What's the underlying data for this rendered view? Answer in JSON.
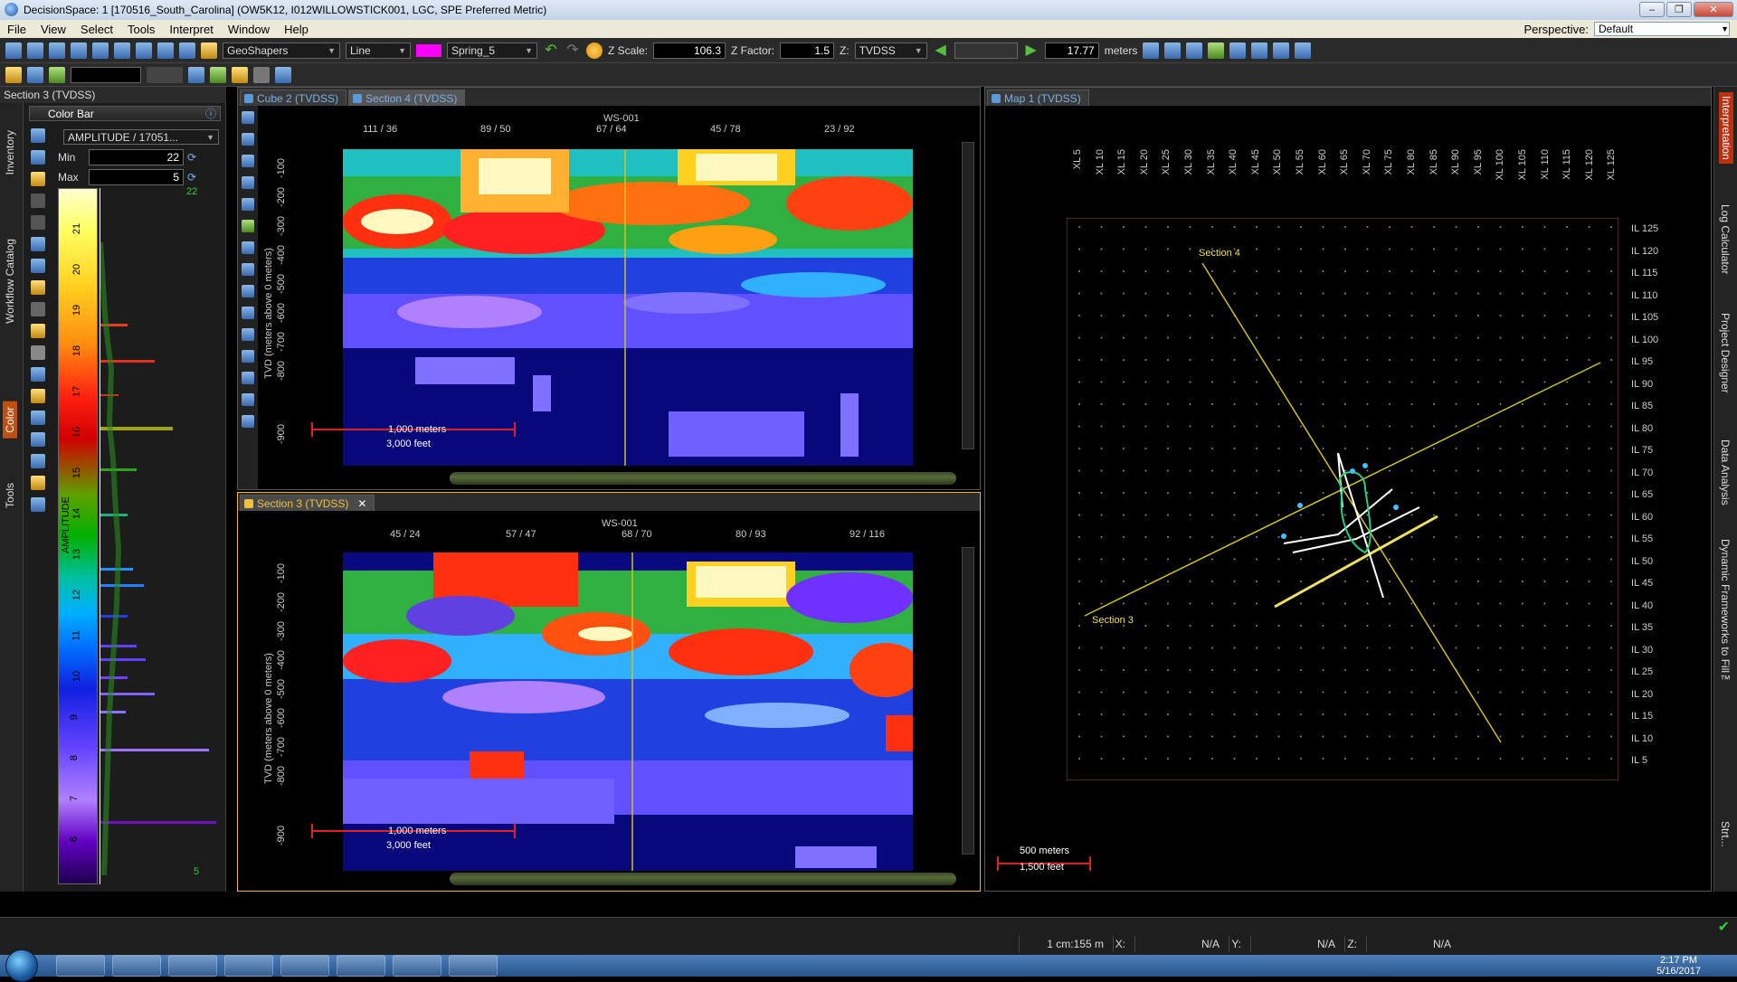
{
  "window": {
    "title": "DecisionSpace: 1 [170516_South_Carolina] (OW5K12, I012WILLOWSTICK001, LGC, SPE Preferred Metric)",
    "min": "–",
    "max": "❐",
    "close": "✕"
  },
  "menu": {
    "items": [
      "File",
      "View",
      "Select",
      "Tools",
      "Interpret",
      "Window",
      "Help"
    ],
    "perspective_label": "Perspective:",
    "perspective_value": "Default"
  },
  "toolbar": {
    "shape_combo": "GeoShapers",
    "style_combo": "Line",
    "color_hex": "#ff00ff",
    "colormap_combo": "Spring_5",
    "zscale_label": "Z Scale:",
    "zscale_value": "106.3",
    "zfactor_label": "Z Factor:",
    "zfactor_value": "1.5",
    "z_label": "Z:",
    "z_value": "TVDSS",
    "distance_value": "17.77",
    "distance_unit": "meters"
  },
  "left_panel": {
    "title": "Section 3 (TVDSS)",
    "side_tabs": [
      "Inventory",
      "Workflow Catalog",
      "Color",
      "Tools"
    ],
    "colorbar_header": "Color Bar",
    "attribute_combo": "AMPLITUDE / 17051...",
    "min_label": "Min",
    "min_value": "22",
    "max_label": "Max",
    "max_value": "5",
    "top_marker": "22",
    "bottom_marker": "5",
    "axis_title": "AMPLITUDE",
    "ticks": [
      "21",
      "20",
      "19",
      "18",
      "17",
      "16",
      "15",
      "14",
      "13",
      "12",
      "11",
      "10",
      "9",
      "8",
      "7",
      "6"
    ]
  },
  "cube_view": {
    "tabs": [
      {
        "label": "Cube 2 (TVDSS)",
        "active": false
      },
      {
        "label": "Section 4 (TVDSS)",
        "active": true
      }
    ],
    "well": "WS-001",
    "top_ticks": [
      "111 / 36",
      "89 / 50",
      "67 / 64",
      "45 / 78",
      "23 / 92"
    ],
    "depth_axis_label": "TVD (meters above 0 meters)",
    "depth_ticks": [
      "-100",
      "-200",
      "-300",
      "-400",
      "-500",
      "-600",
      "-700",
      "-800",
      "-900"
    ],
    "scale_meters": "1,000 meters",
    "scale_feet": "3,000 feet"
  },
  "section3_view": {
    "tab": "Section 3 (TVDSS)",
    "close": "✕",
    "well": "WS-001",
    "top_ticks": [
      "45 / 24",
      "57 / 47",
      "68 / 70",
      "80 / 93",
      "92 / 116"
    ],
    "depth_axis_label": "TVD (meters above 0 meters)",
    "depth_ticks": [
      "-100",
      "-200",
      "-300",
      "-400",
      "-500",
      "-600",
      "-700",
      "-800",
      "-900"
    ],
    "scale_meters": "1,000 meters",
    "scale_feet": "3,000 feet"
  },
  "map_view": {
    "tab": "Map 1 (TVDSS)",
    "xl_labels": [
      "XL 5",
      "XL 10",
      "XL 15",
      "XL 20",
      "XL 25",
      "XL 30",
      "XL 35",
      "XL 40",
      "XL 45",
      "XL 50",
      "XL 55",
      "XL 60",
      "XL 65",
      "XL 70",
      "XL 75",
      "XL 80",
      "XL 85",
      "XL 90",
      "XL 95",
      "XL 100",
      "XL 105",
      "XL 110",
      "XL 115",
      "XL 120",
      "XL 125"
    ],
    "il_labels": [
      "IL 125",
      "IL 120",
      "IL 115",
      "IL 110",
      "IL 105",
      "IL 100",
      "IL 95",
      "IL 90",
      "IL 85",
      "IL 80",
      "IL 75",
      "IL 70",
      "IL 65",
      "IL 60",
      "IL 55",
      "IL 50",
      "IL 45",
      "IL 40",
      "IL 35",
      "IL 30",
      "IL 25",
      "IL 20",
      "IL 15",
      "IL 10",
      "IL 5"
    ],
    "section4_label": "Section 4",
    "section3_label": "Section 3",
    "scale_meters": "500 meters",
    "scale_feet": "1,500 feet"
  },
  "right_tabs": [
    "Interpretation",
    "Log Calculator",
    "Project Designer",
    "Data Analysis",
    "Dynamic Frameworks to Fill™",
    "Strt..."
  ],
  "status": {
    "scale": "1 cm:155 m",
    "x_label": "X:",
    "x_value": "N/A",
    "y_label": "Y:",
    "y_value": "N/A",
    "z_label": "Z:",
    "z_value": "N/A"
  },
  "taskbar": {
    "time": "2:17 PM",
    "date": "5/16/2017"
  }
}
